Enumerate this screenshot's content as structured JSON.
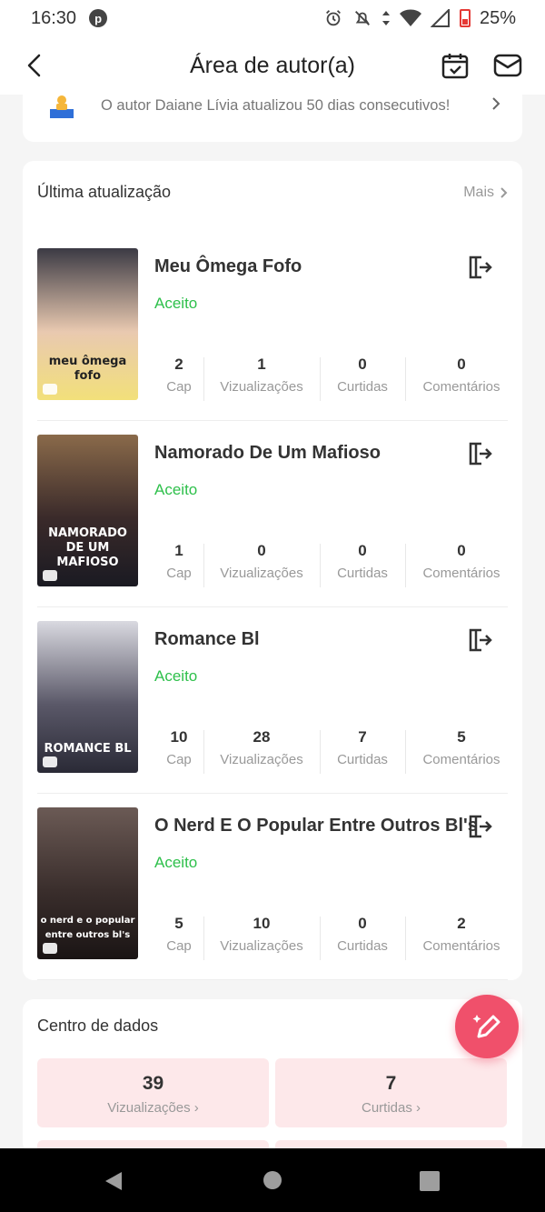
{
  "status_bar": {
    "time": "16:30",
    "pinterest_letter": "p",
    "battery": "25%"
  },
  "header": {
    "title": "Área de autor(a)"
  },
  "banner": {
    "text": "O autor Daiane Lívia atualizou 50 dias consecutivos!"
  },
  "updates": {
    "title": "Última atualização",
    "more": "Mais",
    "books": [
      {
        "title": "Meu Ômega Fofo",
        "status": "Aceito",
        "cover_text": "meu ômega fofo",
        "cover_colors": [
          "#3b3a44",
          "#e9c9b0",
          "#f2e07a"
        ],
        "stats": [
          {
            "value": "2",
            "label": "Cap"
          },
          {
            "value": "1",
            "label": "Vizualizações"
          },
          {
            "value": "0",
            "label": "Curtidas"
          },
          {
            "value": "0",
            "label": "Comentários"
          }
        ]
      },
      {
        "title": "Namorado De Um Mafioso",
        "status": "Aceito",
        "cover_text": "NAMORADO DE UM MAFIOSO",
        "cover_colors": [
          "#8a6a4a",
          "#3a2a2a",
          "#1a1a22"
        ],
        "stats": [
          {
            "value": "1",
            "label": "Cap"
          },
          {
            "value": "0",
            "label": "Vizualizações"
          },
          {
            "value": "0",
            "label": "Curtidas"
          },
          {
            "value": "0",
            "label": "Comentários"
          }
        ]
      },
      {
        "title": "Romance Bl",
        "status": "Aceito",
        "cover_text": "ROMANCE BL",
        "cover_colors": [
          "#d9d9e0",
          "#5a5868",
          "#2a2a36"
        ],
        "stats": [
          {
            "value": "10",
            "label": "Cap"
          },
          {
            "value": "28",
            "label": "Vizualizações"
          },
          {
            "value": "7",
            "label": "Curtidas"
          },
          {
            "value": "5",
            "label": "Comentários"
          }
        ]
      },
      {
        "title": "O Nerd E O Popular Entre Outros Bl's",
        "status": "Aceito",
        "cover_text": "o nerd e o popular entre outros bl's",
        "cover_colors": [
          "#6b5a55",
          "#3a2e2c",
          "#1a1414"
        ],
        "stats": [
          {
            "value": "5",
            "label": "Cap"
          },
          {
            "value": "10",
            "label": "Vizualizações"
          },
          {
            "value": "0",
            "label": "Curtidas"
          },
          {
            "value": "2",
            "label": "Comentários"
          }
        ]
      }
    ]
  },
  "data_center": {
    "title": "Centro de dados",
    "tiles": [
      {
        "value": "39",
        "label": "Vizualizações"
      },
      {
        "value": "7",
        "label": "Curtidas"
      }
    ]
  },
  "colors": {
    "accent": "#f0506b",
    "status_green": "#2ec04b",
    "tile_bg": "#fde8ea"
  }
}
